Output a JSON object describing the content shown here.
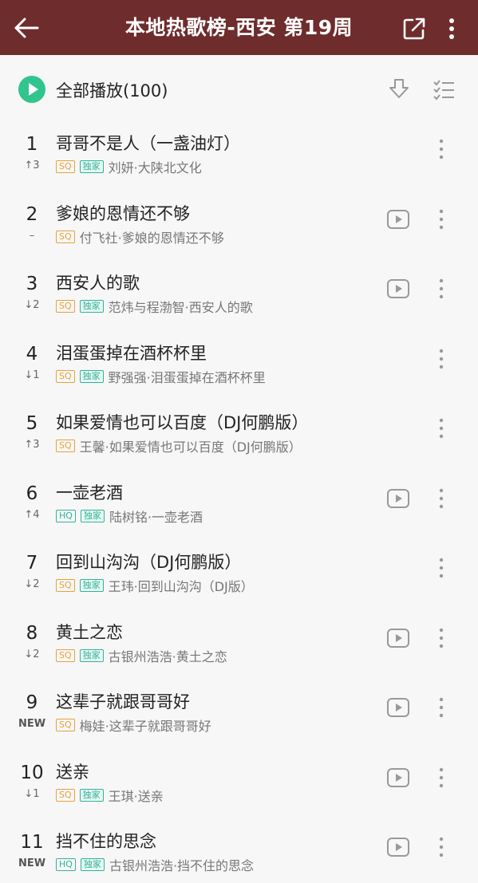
{
  "header": {
    "title": "本地热歌榜-西安 第19周"
  },
  "play_all": {
    "label": "全部播放(100)"
  },
  "colors": {
    "header_bg": "#6f2c2c",
    "accent_green": "#2fc58c",
    "tag_sq": "#e7a23a",
    "tag_green": "#2fb49b"
  },
  "songs": [
    {
      "rank": "1",
      "trend": "↑3",
      "title": "哥哥不是人（一盏油灯）",
      "quality": "SQ",
      "exclusive": "独家",
      "artist": "刘妍·大陕北文化",
      "mv": false
    },
    {
      "rank": "2",
      "trend": "–",
      "title": "爹娘的恩情还不够",
      "quality": "SQ",
      "exclusive": "",
      "artist": "付飞社·爹娘的恩情还不够",
      "mv": true
    },
    {
      "rank": "3",
      "trend": "↓2",
      "title": "西安人的歌",
      "quality": "SQ",
      "exclusive": "独家",
      "artist": "范炜与程渤智·西安人的歌",
      "mv": true
    },
    {
      "rank": "4",
      "trend": "↓1",
      "title": "泪蛋蛋掉在酒杯杯里",
      "quality": "SQ",
      "exclusive": "独家",
      "artist": "野强强·泪蛋蛋掉在酒杯杯里",
      "mv": false
    },
    {
      "rank": "5",
      "trend": "↑3",
      "title": "如果爱情也可以百度（DJ何鹏版）",
      "quality": "SQ",
      "exclusive": "",
      "artist": "王馨·如果爱情也可以百度（DJ何鹏版）",
      "mv": false
    },
    {
      "rank": "6",
      "trend": "↑4",
      "title": "一壶老酒",
      "quality": "HQ",
      "exclusive": "独家",
      "artist": "陆树铭·一壶老酒",
      "mv": true
    },
    {
      "rank": "7",
      "trend": "↓2",
      "title": "回到山沟沟（DJ何鹏版）",
      "quality": "SQ",
      "exclusive": "独家",
      "artist": "王玮·回到山沟沟（DJ版）",
      "mv": false
    },
    {
      "rank": "8",
      "trend": "↓2",
      "title": "黄土之恋",
      "quality": "SQ",
      "exclusive": "独家",
      "artist": "古银州浩浩·黄土之恋",
      "mv": true
    },
    {
      "rank": "9",
      "trend": "NEW",
      "title": "这辈子就跟哥哥好",
      "quality": "SQ",
      "exclusive": "",
      "artist": "梅娃·这辈子就跟哥哥好",
      "mv": true
    },
    {
      "rank": "10",
      "trend": "↓1",
      "title": "送亲",
      "quality": "SQ",
      "exclusive": "独家",
      "artist": "王琪·送亲",
      "mv": true
    },
    {
      "rank": "11",
      "trend": "NEW",
      "title": "挡不住的思念",
      "quality": "HQ",
      "exclusive": "独家",
      "artist": "古银州浩浩·挡不住的思念",
      "mv": true
    }
  ]
}
